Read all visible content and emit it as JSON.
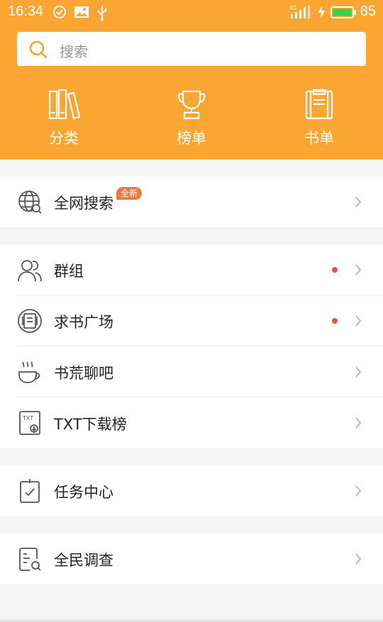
{
  "status_bar": {
    "time": "16:34",
    "battery": "85",
    "network": "4G"
  },
  "search": {
    "placeholder": "搜索"
  },
  "quick_nav": [
    {
      "label": "分类",
      "icon": "books-icon"
    },
    {
      "label": "榜单",
      "icon": "trophy-icon"
    },
    {
      "label": "书单",
      "icon": "booklist-icon"
    }
  ],
  "groups": [
    [
      {
        "label": "全网搜索",
        "icon": "globe-search-icon",
        "badge": "全新"
      }
    ],
    [
      {
        "label": "群组",
        "icon": "users-icon",
        "dot": true
      },
      {
        "label": "求书广场",
        "icon": "book-request-icon",
        "dot": true
      },
      {
        "label": "书荒聊吧",
        "icon": "coffee-icon"
      },
      {
        "label": "TXT下载榜",
        "icon": "txt-download-icon",
        "icon_text": "TXT"
      }
    ],
    [
      {
        "label": "任务中心",
        "icon": "clipboard-check-icon"
      }
    ],
    [
      {
        "label": "全民调查",
        "icon": "survey-icon"
      }
    ]
  ],
  "colors": {
    "header": "#fba532",
    "badge": "#ef7a3b",
    "dot": "#e0524a",
    "background": "#f5f5f5"
  }
}
